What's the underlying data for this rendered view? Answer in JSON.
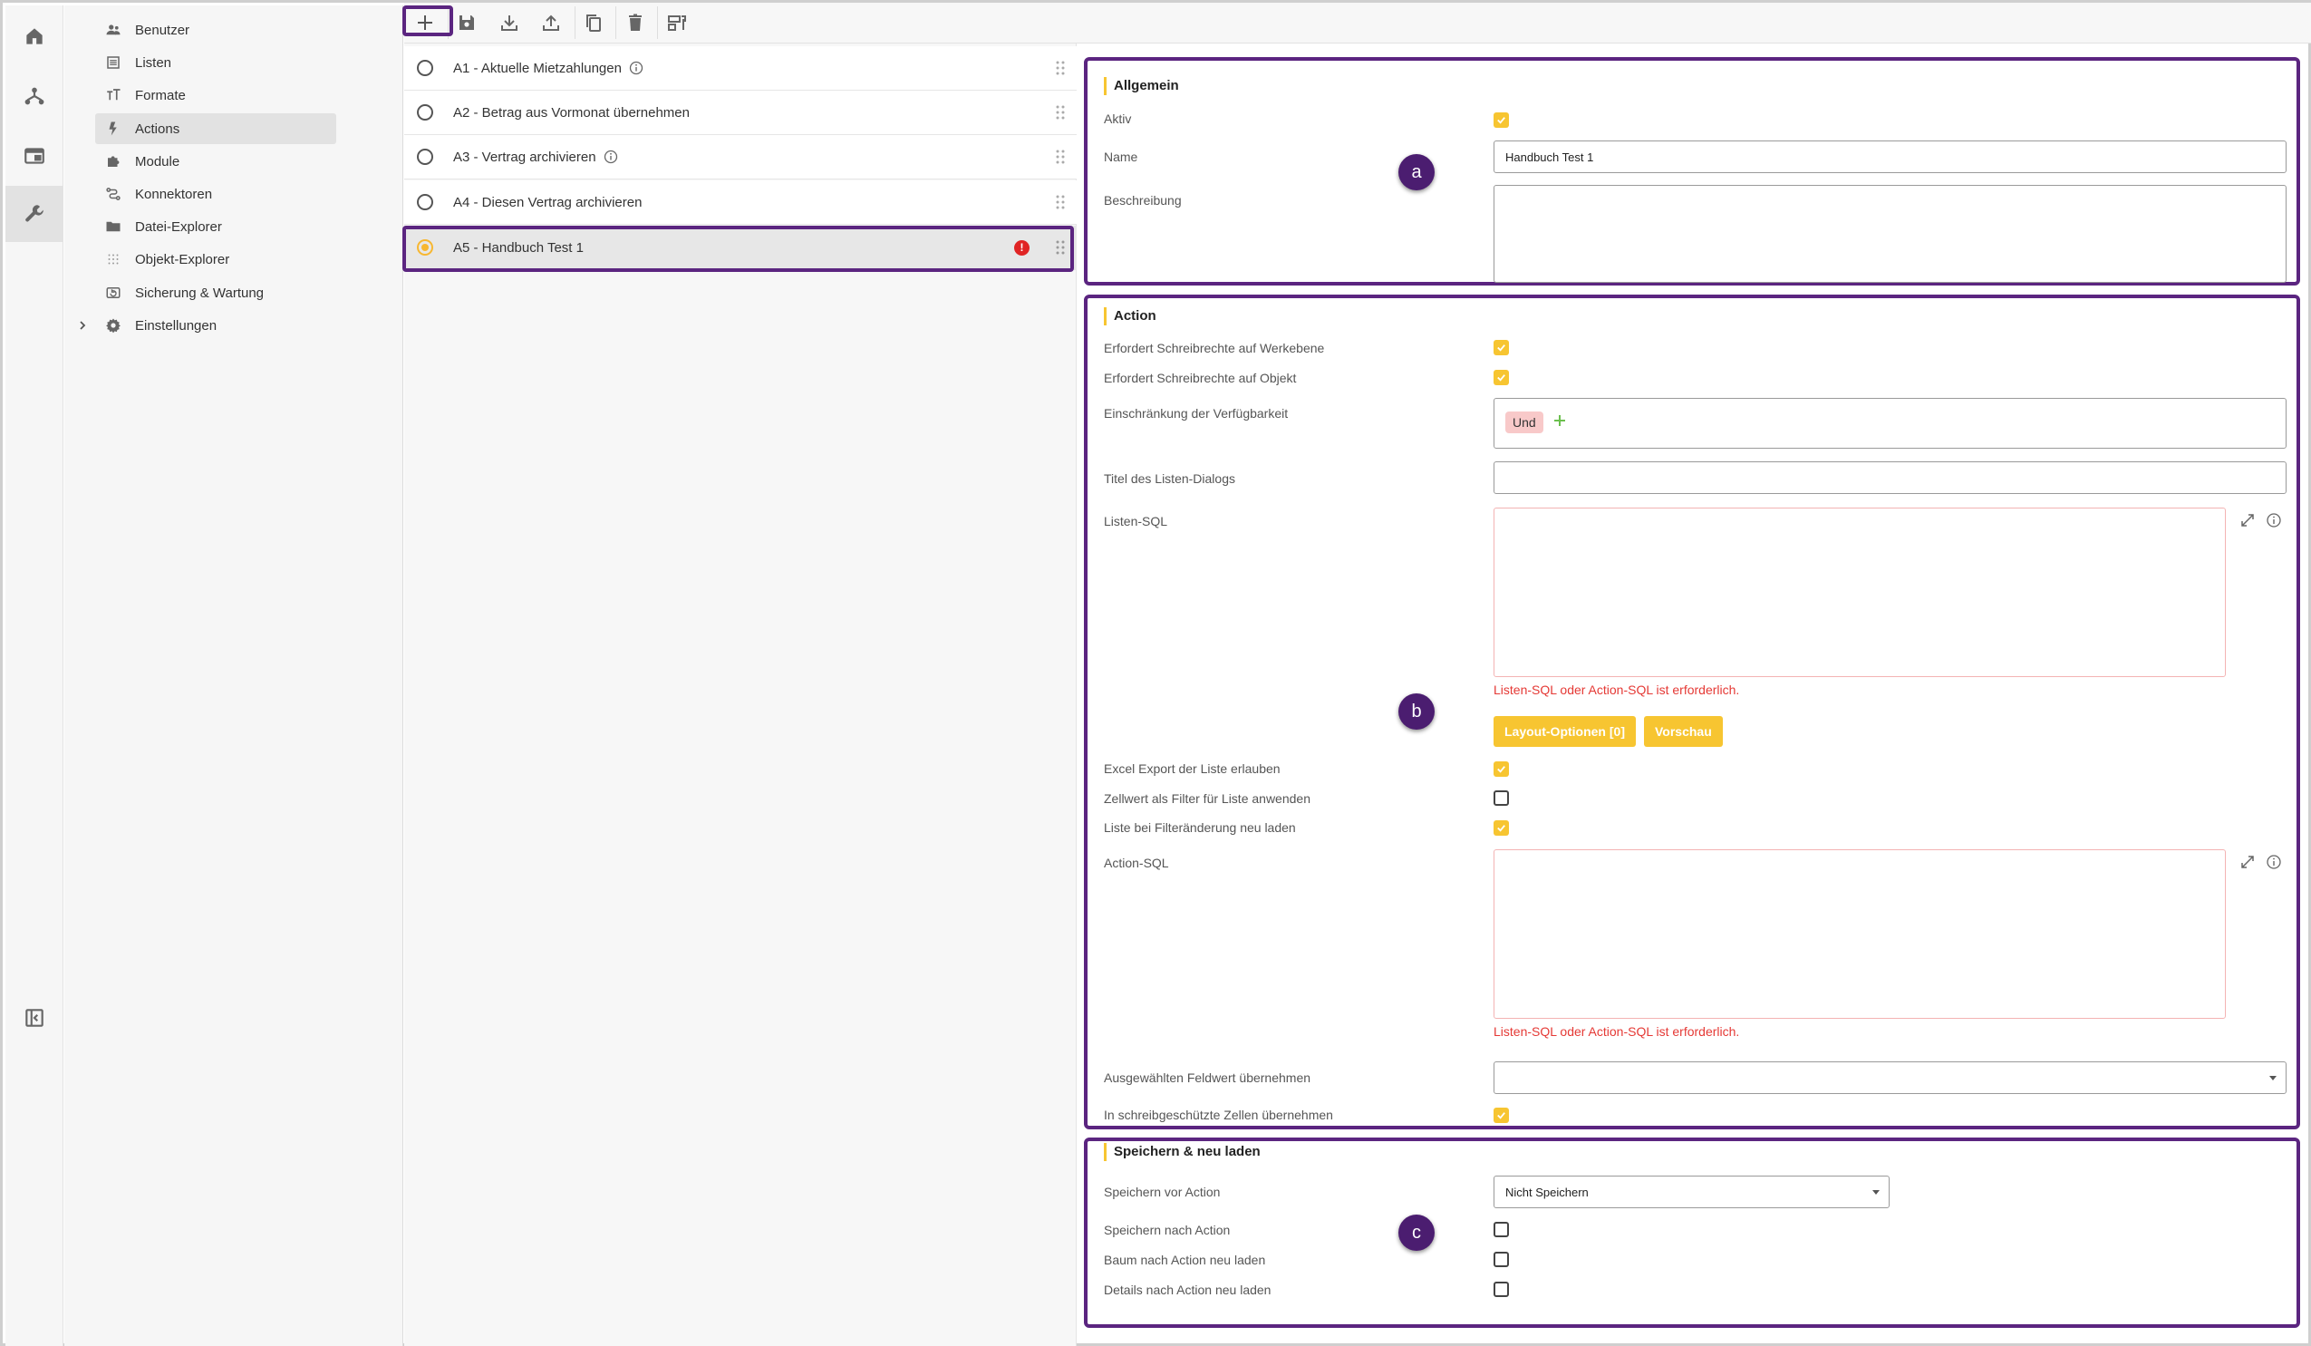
{
  "colors": {
    "accent": "#f7c531",
    "highlight": "#5b2580",
    "badge": "#4b1d70",
    "error": "#e53935"
  },
  "rail": {
    "icons": [
      "home-icon",
      "hierarchy-icon",
      "window-icon",
      "wrench-icon",
      "collapse-panel-icon"
    ]
  },
  "nav": {
    "items": [
      {
        "label": "Benutzer",
        "icon": "users-icon"
      },
      {
        "label": "Listen",
        "icon": "list-icon"
      },
      {
        "label": "Formate",
        "icon": "text-format-icon"
      },
      {
        "label": "Actions",
        "icon": "bolt-icon"
      },
      {
        "label": "Module",
        "icon": "puzzle-icon"
      },
      {
        "label": "Konnektoren",
        "icon": "connector-icon"
      },
      {
        "label": "Datei-Explorer",
        "icon": "folder-icon"
      },
      {
        "label": "Objekt-Explorer",
        "icon": "grid-icon"
      },
      {
        "label": "Sicherung & Wartung",
        "icon": "backup-icon"
      },
      {
        "label": "Einstellungen",
        "icon": "gear-icon"
      }
    ]
  },
  "toolbar": {
    "icons": [
      "add-icon",
      "save-icon",
      "download-icon",
      "upload-icon",
      "copy-icon",
      "delete-icon",
      "layout-icon"
    ]
  },
  "actions": [
    {
      "label": "A1 - Aktuelle Mietzahlungen",
      "info": true
    },
    {
      "label": "A2 - Betrag aus Vormonat übernehmen",
      "info": false
    },
    {
      "label": "A3 - Vertrag archivieren",
      "info": true
    },
    {
      "label": "A4 - Diesen Vertrag archivieren",
      "info": false
    },
    {
      "label": "A5 - Handbuch Test 1",
      "info": false,
      "error_icon": "!"
    }
  ],
  "allgemein": {
    "title": "Allgemein",
    "aktiv_label": "Aktiv",
    "name_label": "Name",
    "name_value": "Handbuch Test 1",
    "beschreibung_label": "Beschreibung"
  },
  "action": {
    "title": "Action",
    "werkebene_label": "Erfordert Schreibrechte auf Werkebene",
    "objekt_label": "Erfordert Schreibrechte auf Objekt",
    "einschraenkung_label": "Einschränkung der Verfügbarkeit",
    "chip": "Und",
    "titel_label": "Titel des Listen-Dialogs",
    "listen_sql_label": "Listen-SQL",
    "sql_error": "Listen-SQL oder Action-SQL ist erforderlich.",
    "layout_btn": "Layout-Optionen [0]",
    "vorschau_btn": "Vorschau",
    "excel_label": "Excel Export der Liste erlauben",
    "zellwert_label": "Zellwert als Filter für Liste anwenden",
    "neu_laden_label": "Liste bei Filteränderung neu laden",
    "action_sql_label": "Action-SQL",
    "feldwert_label": "Ausgewählten Feldwert übernehmen",
    "schreibgeschuetzt_label": "In schreibgeschützte Zellen übernehmen"
  },
  "speichern": {
    "title": "Speichern & neu laden",
    "vor_label": "Speichern vor Action",
    "vor_value": "Nicht Speichern",
    "nach_label": "Speichern nach Action",
    "baum_label": "Baum nach Action neu laden",
    "details_label": "Details nach Action neu laden"
  },
  "badges": {
    "a": "a",
    "b": "b",
    "c": "c"
  }
}
